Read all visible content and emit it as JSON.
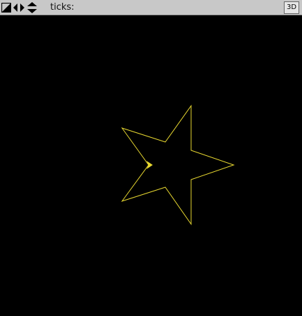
{
  "toolbar": {
    "ticks_label": "ticks:",
    "view_3d_label": "3D"
  },
  "icons": {
    "zoom": "zoom-icon",
    "pan_horizontal": "pan-horizontal-icon",
    "pan_vertical": "pan-vertical-icon"
  },
  "colors": {
    "canvas_background": "#000000",
    "toolbar_background": "#c8c8c8",
    "shape_stroke": "#e8d830"
  },
  "scene": {
    "shape": "star",
    "points": 5,
    "turtle_marker": "arrowhead"
  }
}
